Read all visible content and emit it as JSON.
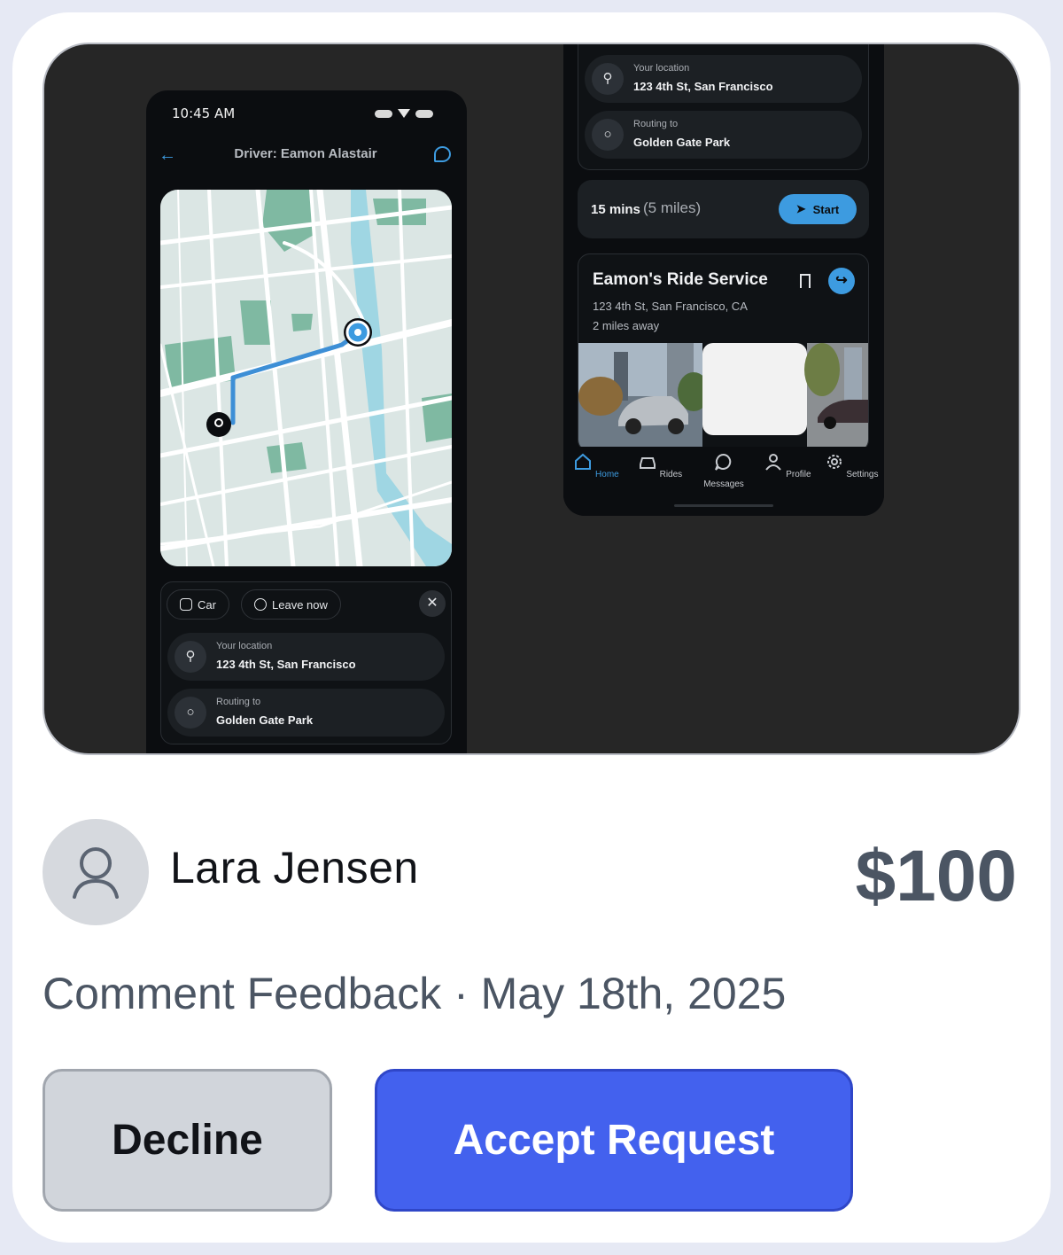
{
  "preview": {
    "left_phone": {
      "status_time": "10:45 AM",
      "header_title": "Driver: Eamon Alastair",
      "chips": [
        "Car",
        "Leave now"
      ],
      "your_location_label": "Your location",
      "your_location_value": "123 4th St, San Francisco",
      "routing_label": "Routing to",
      "routing_value": "Golden Gate Park"
    },
    "right_phone": {
      "your_location_label": "Your location",
      "your_location_value": "123 4th St, San Francisco",
      "routing_label": "Routing to",
      "routing_value": "Golden Gate Park",
      "eta_time": "15 mins",
      "eta_distance": "(5 miles)",
      "start_label": "Start",
      "service_name": "Eamon's Ride Service",
      "service_address": "123 4th St, San Francisco, CA",
      "service_distance": "2 miles away",
      "nav": [
        "Home",
        "Rides",
        "Messages",
        "Profile",
        "Settings"
      ]
    }
  },
  "requester": {
    "name": "Lara Jensen",
    "price": "$100",
    "meta": "Comment Feedback · May 18th, 2025"
  },
  "actions": {
    "decline_label": "Decline",
    "accept_label": "Accept Request"
  },
  "colors": {
    "accent": "#4361ee",
    "app_accent": "#3d9be0",
    "preview_bg": "#262626"
  }
}
